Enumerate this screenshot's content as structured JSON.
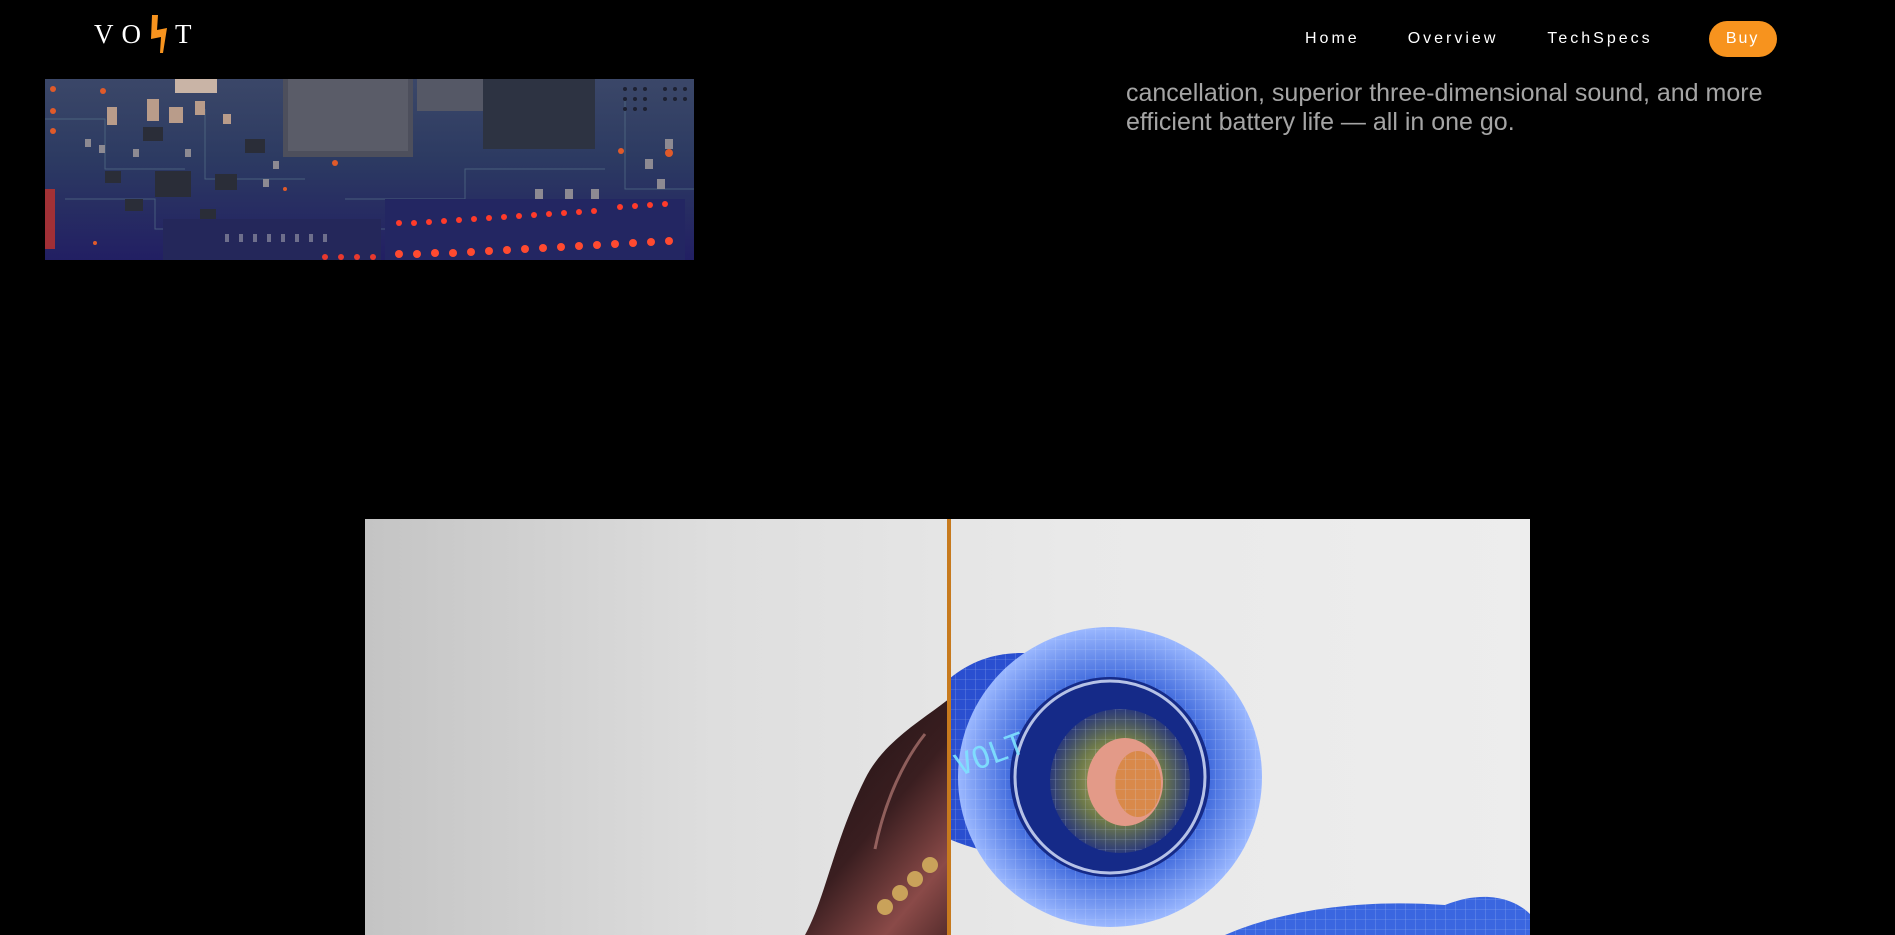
{
  "nav": {
    "logo_text_left": "VO",
    "logo_text_right": "T",
    "links": [
      "Home",
      "Overview",
      "TechSpecs"
    ],
    "buy_label": "Buy",
    "accent_color": "#f7931e"
  },
  "intro": {
    "description": "cancellation, superior three-dimensional sound, and more efficient battery life — all in one go."
  },
  "product_view": {
    "earbud_label": "VOLT",
    "divider_color": "#c77a1e"
  },
  "icons": {
    "logo_mark": "lightning-bolt-icon"
  }
}
